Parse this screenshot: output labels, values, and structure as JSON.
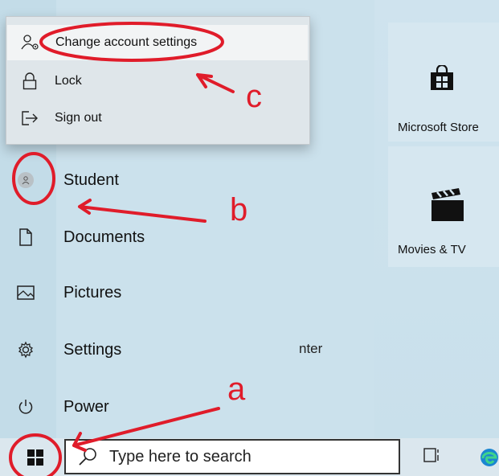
{
  "flyout": {
    "items": [
      {
        "label": "Change account settings",
        "icon": "account-settings-icon"
      },
      {
        "label": "Lock",
        "icon": "lock-icon"
      },
      {
        "label": "Sign out",
        "icon": "sign-out-icon"
      }
    ]
  },
  "start_menu": {
    "items": [
      {
        "label": "Student",
        "icon": "avatar-icon"
      },
      {
        "label": "Documents",
        "icon": "document-icon"
      },
      {
        "label": "Pictures",
        "icon": "pictures-icon"
      },
      {
        "label": "Settings",
        "icon": "gear-icon"
      },
      {
        "label": "Power",
        "icon": "power-icon"
      }
    ],
    "partial_tile_text": "nter"
  },
  "tiles": [
    {
      "label": "Microsoft Store",
      "icon": "store-bag-icon"
    },
    {
      "label": "Movies & TV",
      "icon": "clapperboard-icon"
    }
  ],
  "taskbar": {
    "search_placeholder": "Type here to search"
  },
  "annotations": {
    "a": "a",
    "b": "b",
    "c": "c",
    "color": "#e01c2a"
  }
}
